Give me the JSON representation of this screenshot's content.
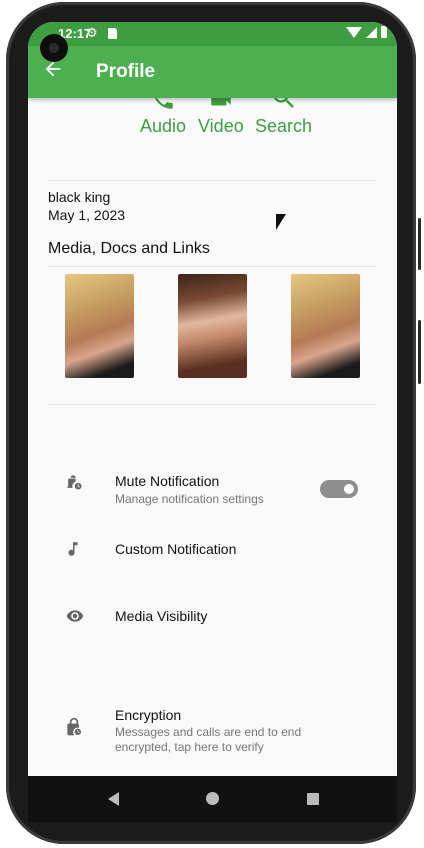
{
  "status_bar": {
    "time": "12:17"
  },
  "appbar": {
    "back_icon": "arrow-left-icon",
    "title": "Profile"
  },
  "actions": [
    {
      "label": "Audio",
      "icon": "phone-icon"
    },
    {
      "label": "Video",
      "icon": "video-icon"
    },
    {
      "label": "Search",
      "icon": "search-icon"
    }
  ],
  "profile": {
    "name": "black king",
    "date": "May 1, 2023"
  },
  "media": {
    "title": "Media, Docs and Links",
    "thumbnails": 3
  },
  "settings": {
    "mute": {
      "title": "Mute Notification",
      "subtitle": "Manage notification settings",
      "toggle_on": true
    },
    "custom": {
      "title": "Custom Notification"
    },
    "visibility": {
      "title": "Media Visibility"
    },
    "encryption": {
      "title": "Encryption",
      "subtitle": "Messages and calls are end to end encrypted, tap here to verify"
    }
  },
  "colors": {
    "primary": "#4caf50",
    "status": "#3d9d40",
    "accent_text": "#3e9e43"
  }
}
